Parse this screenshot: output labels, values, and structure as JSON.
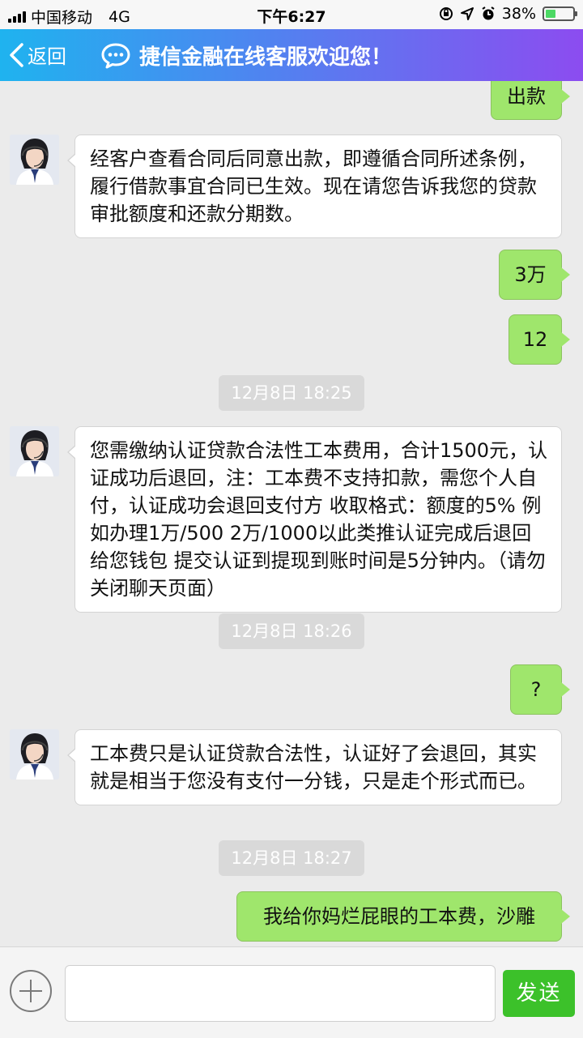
{
  "status_bar": {
    "carrier": "中国移动",
    "network": "4G",
    "time": "下午6:27",
    "battery_percent": "38%",
    "battery_level": 0.38
  },
  "header": {
    "back_label": "返回",
    "title": "捷信金融在线客服欢迎您！",
    "gradient_colors": [
      "#1fb3ef",
      "#4f84f0",
      "#8c4cf0"
    ]
  },
  "messages": [
    {
      "side": "right",
      "text": "出款"
    },
    {
      "side": "left",
      "text": "经客户查看合同后同意出款，即遵循合同所述条例，履行借款事宜合同已生效。现在请您告诉我您的贷款审批额度和还款分期数。"
    },
    {
      "side": "right",
      "text": "3万"
    },
    {
      "side": "right",
      "text": "12"
    },
    {
      "type": "time",
      "text": "12月8日 18:25"
    },
    {
      "side": "left",
      "text": "您需缴纳认证贷款合法性工本费用，合计1500元，认证成功后退回，注：工本费不支持扣款，需您个人自付，认证成功会退回支付方 收取格式：额度的5% 例如办理1万/500 2万/1000以此类推认证完成后退回给您钱包 提交认证到提现到账时间是5分钟内。（请勿关闭聊天页面）"
    },
    {
      "type": "time",
      "text": "12月8日 18:26"
    },
    {
      "side": "right",
      "text": "?"
    },
    {
      "side": "left",
      "text": "工本费只是认证贷款合法性，认证好了会退回，其实就是相当于您没有支付一分钱，只是走个形式而已。"
    },
    {
      "type": "time",
      "text": "12月8日 18:27"
    },
    {
      "side": "right",
      "text": "我给你妈烂屁眼的工本费，沙雕"
    }
  ],
  "input_bar": {
    "placeholder": "",
    "send_label": "发送"
  },
  "colors": {
    "background": "#ebebeb",
    "user_bubble": "#9fe66c",
    "agent_bubble": "#ffffff",
    "send_button": "#3cc12a"
  }
}
